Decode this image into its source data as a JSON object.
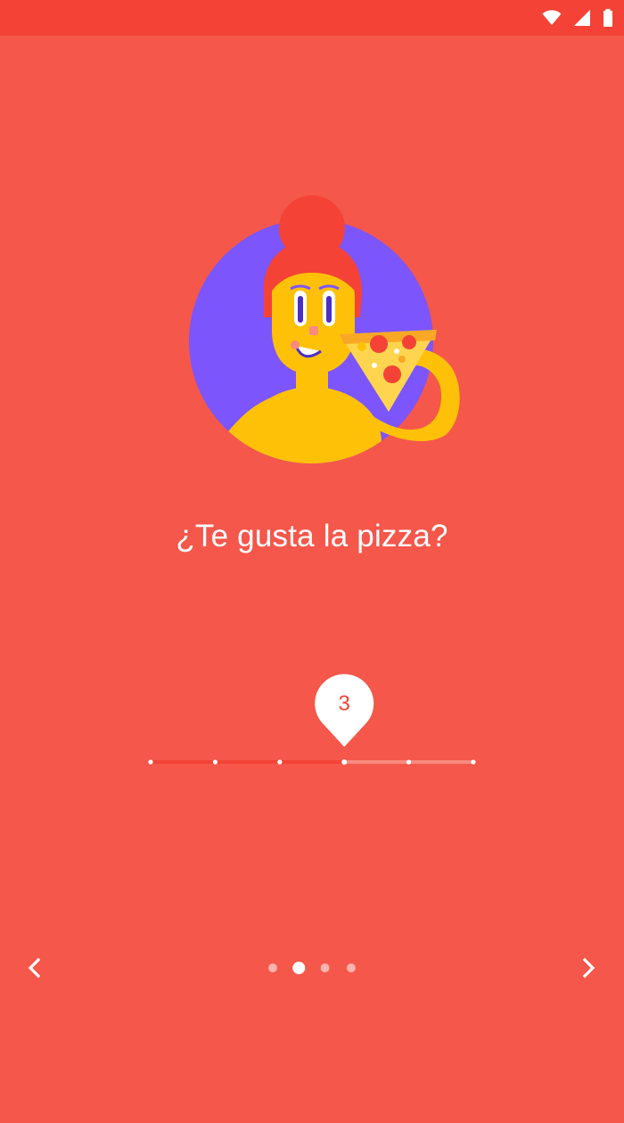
{
  "status_bar": {
    "wifi_icon": "wifi-icon",
    "signal_icon": "cell-signal-icon",
    "battery_icon": "battery-icon"
  },
  "illustration": {
    "name": "woman-eating-pizza-illustration"
  },
  "question": {
    "text": "¿Te gusta la pizza?"
  },
  "rating_slider": {
    "min": 0,
    "max": 5,
    "value": 3,
    "value_label": "3",
    "active_color": "#F44336",
    "inactive_color": "#F88A80",
    "thumb_color": "#FFFFFF"
  },
  "navigation": {
    "prev_icon": "chevron-left-icon",
    "next_icon": "chevron-right-icon"
  },
  "pagination": {
    "total": 4,
    "current": 2
  },
  "colors": {
    "background": "#F5574B",
    "status_bar": "#F44336",
    "circle": "#7C55FC",
    "skin": "#FFC107"
  }
}
